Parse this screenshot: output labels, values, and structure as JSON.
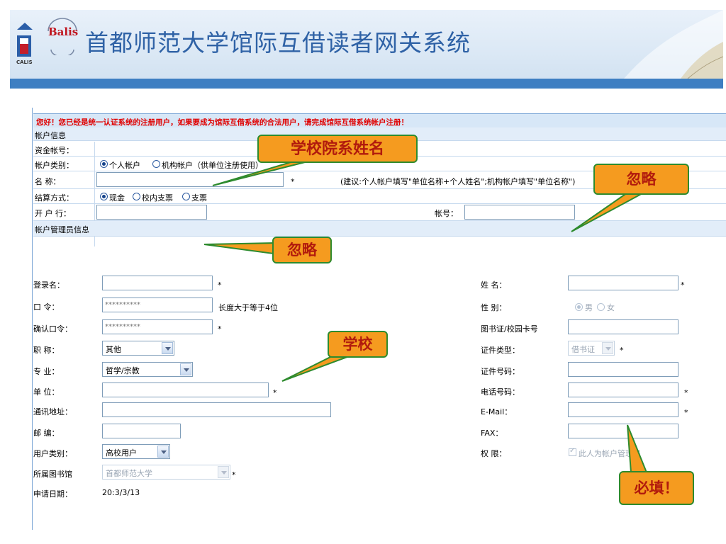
{
  "header": {
    "title": "首都师范大学馆际互借读者网关系统",
    "calis_logo_text": "CALIS",
    "balis_logo_text": "Balis"
  },
  "notice": "您好！您已经是统一认证系统的注册用户，如果要成为馆际互借系统的合法用户，请完成馆际互借系统帐户注册！",
  "account_section": {
    "heading": "帐户信息",
    "fund_account_label": "资金帐号：",
    "type_label": "帐户类别：",
    "type_options": [
      "个人帐户",
      "机构帐户（供单位注册使用）"
    ],
    "type_selected": 0,
    "name_label": "名 称：",
    "name_hint": "(建议:个人帐户填写\"单位名称+个人姓名\";机构帐户填写\"单位名称\")",
    "settle_label": "结算方式：",
    "settle_options": [
      "现金",
      "校内支票",
      "支票"
    ],
    "settle_selected": 0,
    "bank_label": "开 户 行：",
    "bank_account_label": "帐号："
  },
  "admin_section": {
    "heading": "帐户管理员信息",
    "login_label": "登录名：",
    "password_label": "口 令：",
    "password_value": "**********",
    "password_hint": "长度大于等于4位",
    "confirm_label": "确认口令：",
    "confirm_value": "**********",
    "title_label": "职 称：",
    "title_value": "其他",
    "major_label": "专 业：",
    "major_value": "哲学/宗教",
    "unit_label": "单 位：",
    "address_label": "通讯地址：",
    "zip_label": "邮 编：",
    "usertype_label": "用户类别：",
    "usertype_value": "高校用户",
    "library_label": "所属图书馆",
    "library_value": "首都师范大学",
    "date_label": "申请日期：",
    "date_value": "20:3/3/13",
    "realname_label": "姓 名：",
    "gender_label": "性 别：",
    "gender_options": [
      "男",
      "女"
    ],
    "gender_selected": 0,
    "card_label": "图书证/校园卡号",
    "idtype_label": "证件类型：",
    "idtype_value": "借书证",
    "idnum_label": "证件号码：",
    "phone_label": "电话号码：",
    "email_label": "E-Mail：",
    "fax_label": "FAX：",
    "perm_label": "权 限：",
    "perm_option": "此人为帐户管理员",
    "required_mark": "*"
  },
  "callouts": {
    "top": "学校院系姓名",
    "right_top": "忽略",
    "middle": "忽略",
    "school": "学校",
    "required": "必填！"
  },
  "colors": {
    "title_blue": "#2f62a6",
    "notice_red": "#e00000",
    "callout_fill": "#f59b1f",
    "callout_border": "#2e8b2e",
    "callout_text": "#b11a0d"
  }
}
